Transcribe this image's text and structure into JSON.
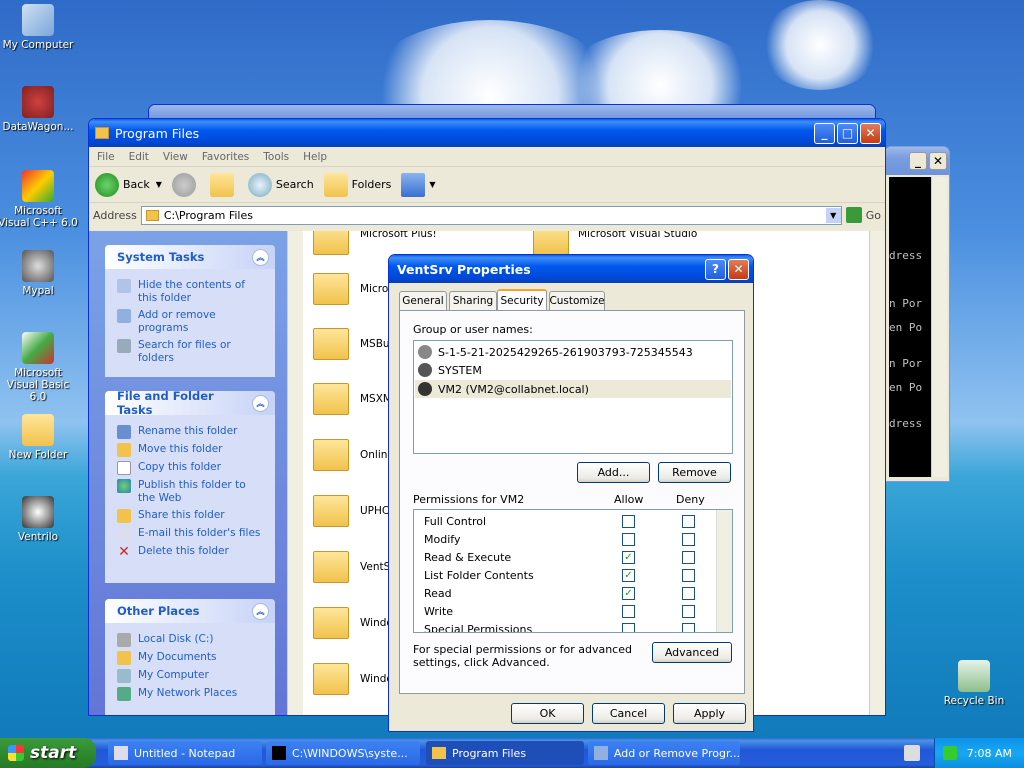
{
  "desktop": {
    "icons": [
      {
        "label": "My Computer"
      },
      {
        "label": "DataWagon..."
      },
      {
        "label": "Microsoft Visual C++ 6.0"
      },
      {
        "label": "Mypal"
      },
      {
        "label": "Microsoft Visual Basic 6.0"
      },
      {
        "label": "New Folder"
      },
      {
        "label": "Ventrilo"
      },
      {
        "label": "Recycle Bin"
      }
    ]
  },
  "explorer": {
    "title": "Program Files",
    "menu": [
      "File",
      "Edit",
      "View",
      "Favorites",
      "Tools",
      "Help"
    ],
    "toolbar": {
      "back": "Back",
      "search": "Search",
      "folders": "Folders"
    },
    "address": {
      "label": "Address",
      "value": "C:\\Program Files",
      "go": "Go"
    },
    "system_tasks": {
      "title": "System Tasks",
      "items": [
        "Hide the contents of this folder",
        "Add or remove programs",
        "Search for files or folders"
      ]
    },
    "file_folder_tasks": {
      "title": "File and Folder Tasks",
      "items": [
        "Rename this folder",
        "Move this folder",
        "Copy this folder",
        "Publish this folder to the Web",
        "Share this folder",
        "E-mail this folder's files",
        "Delete this folder"
      ]
    },
    "other_places": {
      "title": "Other Places",
      "items": [
        "Local Disk (C:)",
        "My Documents",
        "My Computer",
        "My Network Places"
      ]
    },
    "folders_left": [
      "Microsoft Plus!",
      "Micros",
      "MSBui",
      "MSXM",
      "Online",
      "UPHCl",
      "VentS",
      "Windo",
      "Windo"
    ],
    "folders_right": [
      "Microsoft Visual Studio"
    ]
  },
  "console": {
    "lines": [
      "dress",
      "n Por",
      "en Po",
      "n Por",
      "en Po",
      "dress"
    ]
  },
  "dialog": {
    "title": "VentSrv Properties",
    "tabs": [
      "General",
      "Sharing",
      "Security",
      "Customize"
    ],
    "group_label": "Group or user names:",
    "users": [
      "S-1-5-21-2025429265-261903793-725345543",
      "SYSTEM",
      "VM2 (VM2@collabnet.local)"
    ],
    "add_button": "Add...",
    "remove_button": "Remove",
    "permissions_label": "Permissions for VM2",
    "allow_label": "Allow",
    "deny_label": "Deny",
    "permissions": [
      {
        "name": "Full Control",
        "allow": false,
        "deny": false
      },
      {
        "name": "Modify",
        "allow": false,
        "deny": false
      },
      {
        "name": "Read & Execute",
        "allow": true,
        "deny": false
      },
      {
        "name": "List Folder Contents",
        "allow": true,
        "deny": false
      },
      {
        "name": "Read",
        "allow": true,
        "deny": false
      },
      {
        "name": "Write",
        "allow": false,
        "deny": false
      },
      {
        "name": "Special Permissions",
        "allow": false,
        "deny": false
      }
    ],
    "special_text": "For special permissions or for advanced settings, click Advanced.",
    "advanced_button": "Advanced",
    "ok": "OK",
    "cancel": "Cancel",
    "apply": "Apply"
  },
  "taskbar": {
    "start": "start",
    "items": [
      "Untitled - Notepad",
      "C:\\WINDOWS\\syste...",
      "Program Files",
      "Add or Remove Progr..."
    ],
    "clock": "7:08 AM"
  }
}
